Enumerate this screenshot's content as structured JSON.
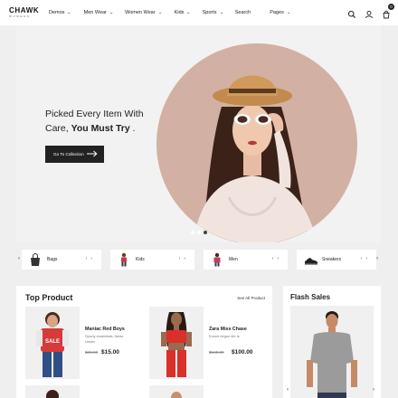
{
  "header": {
    "logo": "CHAWK",
    "logo_sub": "WOMENS",
    "nav": [
      {
        "label": "Demos",
        "dropdown": true
      },
      {
        "label": "Men Wear",
        "dropdown": true
      },
      {
        "label": "Women Wear",
        "dropdown": true
      },
      {
        "label": "Kids",
        "dropdown": true
      },
      {
        "label": "Sports",
        "dropdown": true
      },
      {
        "label": "Search",
        "dropdown": false
      },
      {
        "label": "Pages",
        "dropdown": true
      }
    ],
    "cart_count": "0"
  },
  "hero": {
    "text_line1": "Picked Every Item With",
    "text_line2_plain": "Care, ",
    "text_line2_bold": "You Must Try",
    "text_line2_end": " .",
    "button_label": "Go To Collection"
  },
  "categories": [
    {
      "label": "Bags"
    },
    {
      "label": "Kids"
    },
    {
      "label": "Men"
    },
    {
      "label": "Sneakers"
    }
  ],
  "top_product": {
    "title": "Top Product",
    "see_all": "See All Product",
    "products": [
      {
        "name": "Maniac Red Boys",
        "desc": "Sporty essentials, these Under",
        "old_price": "$20.00",
        "price": "$15.00"
      },
      {
        "name": "Zara Miss Chase",
        "desc": "Knock begun life is",
        "old_price": "$120.00",
        "price": "$100.00"
      }
    ]
  },
  "flash_sales": {
    "title": "Flash Sales"
  },
  "colors": {
    "accent": "#222222",
    "hero_circle": "#d2b0a4",
    "background": "#efefef"
  }
}
